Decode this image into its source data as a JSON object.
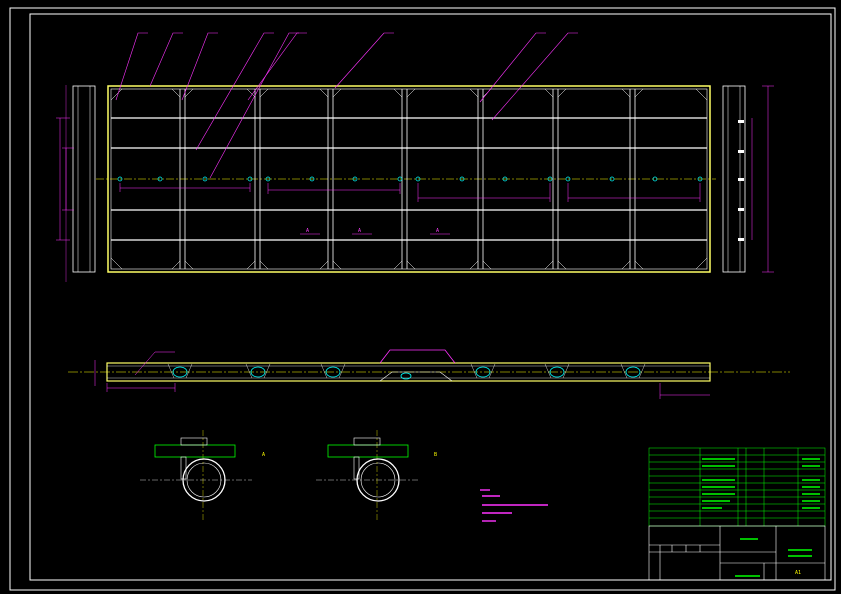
{
  "drawing": {
    "background": "#000000",
    "colors": {
      "frame": "#ffffff",
      "outline": "#ffff66",
      "member": "#ffffff",
      "leader": "#ff33ff",
      "dimension": "#ff33ff",
      "table": "#00ff00",
      "centerline": "#ffff00",
      "anchor": "#00ffff"
    },
    "detail_marks": [
      "A",
      "A",
      "A"
    ],
    "detail_labels": [
      "A",
      "B"
    ],
    "title_block": {
      "scale": "A1"
    }
  }
}
